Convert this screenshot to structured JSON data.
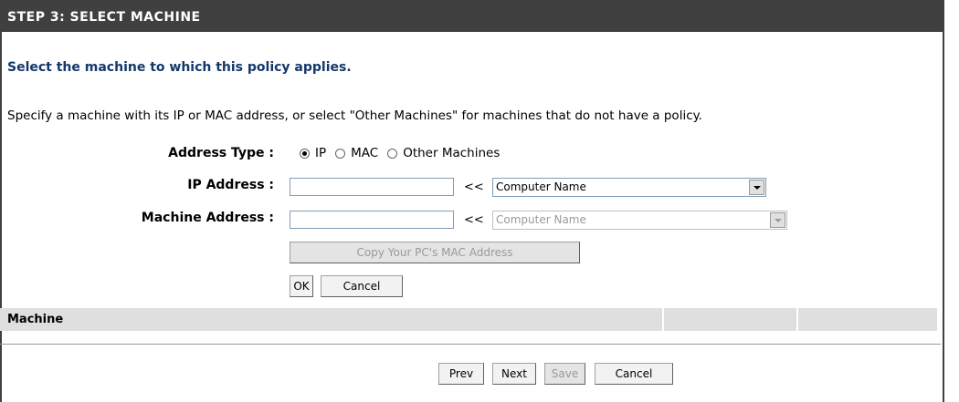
{
  "header": {
    "title": "STEP 3: SELECT MACHINE"
  },
  "subtitle": "Select the machine to which this policy applies.",
  "description": "Specify a machine with its IP or MAC address, or select \"Other Machines\" for machines that do not have a policy.",
  "form": {
    "address_type_label": "Address Type :",
    "address_type_options": [
      "IP",
      "MAC",
      "Other Machines"
    ],
    "address_type_selected": "IP",
    "ip_label": "IP Address :",
    "ip_value": "",
    "machine_label": "Machine Address :",
    "machine_value": "",
    "arrows": "<<",
    "computer_select": "Computer Name",
    "computer_select_disabled": "Computer Name",
    "copy_mac_button": "Copy Your PC's MAC Address",
    "ok_button": "OK",
    "cancel_button": "Cancel"
  },
  "table": {
    "columns": [
      "Machine",
      "",
      ""
    ]
  },
  "footer": {
    "prev": "Prev",
    "next": "Next",
    "save": "Save",
    "cancel": "Cancel"
  }
}
